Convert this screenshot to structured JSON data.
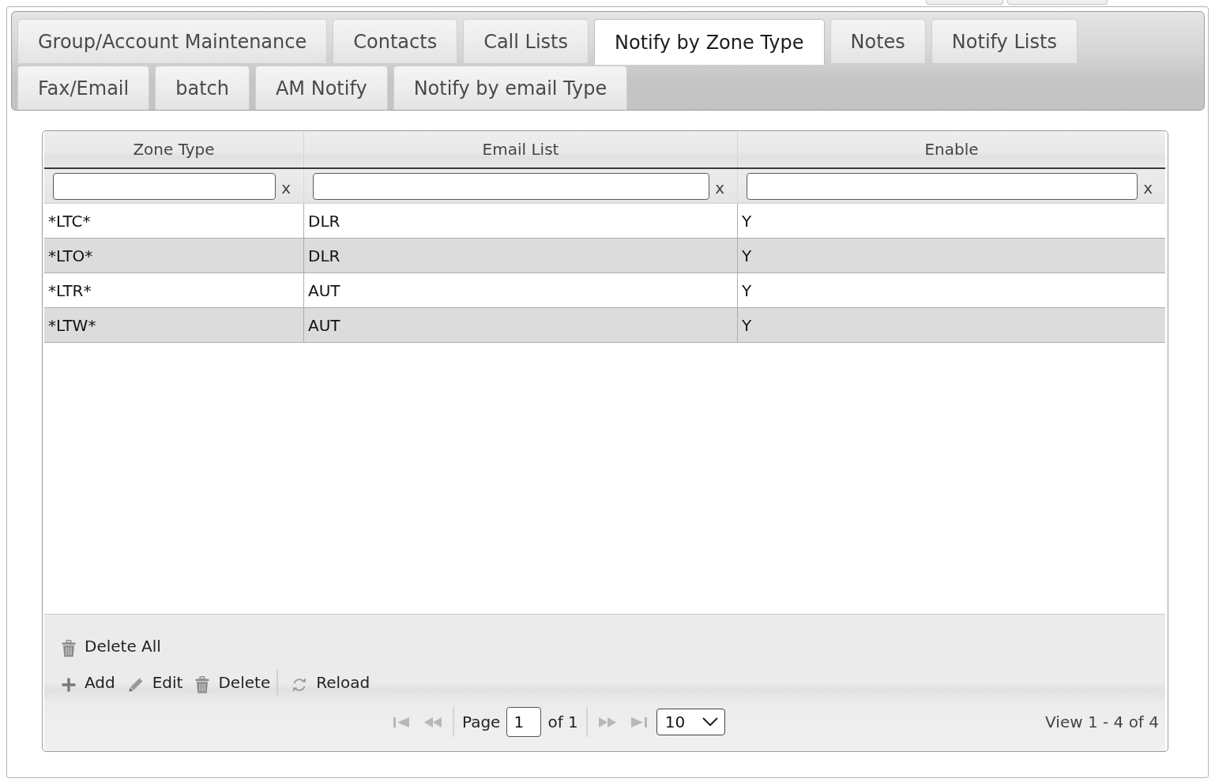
{
  "tabs": [
    {
      "label": "Group/Account Maintenance",
      "selected": false
    },
    {
      "label": "Contacts",
      "selected": false
    },
    {
      "label": "Call Lists",
      "selected": false
    },
    {
      "label": "Notify by Zone Type",
      "selected": true
    },
    {
      "label": "Notes",
      "selected": false
    },
    {
      "label": "Notify Lists",
      "selected": false
    },
    {
      "label": "Fax/Email",
      "selected": false
    },
    {
      "label": "batch",
      "selected": false
    },
    {
      "label": "AM Notify",
      "selected": false
    },
    {
      "label": "Notify by email Type",
      "selected": false
    }
  ],
  "grid": {
    "columns": [
      {
        "label": "Zone Type",
        "filter_clear": "x"
      },
      {
        "label": "Email List",
        "filter_clear": "x"
      },
      {
        "label": "Enable",
        "filter_clear": "x"
      }
    ],
    "rows": [
      {
        "cells": [
          "*LTC*",
          "DLR",
          "Y"
        ],
        "selected": false
      },
      {
        "cells": [
          "*LTO*",
          "DLR",
          "Y"
        ],
        "selected": false
      },
      {
        "cells": [
          "*LTR*",
          "AUT",
          "Y"
        ],
        "selected": false
      },
      {
        "cells": [
          "*LTW*",
          "AUT",
          "Y"
        ],
        "selected": false
      }
    ]
  },
  "toolbar": {
    "rows": [
      [
        {
          "kind": "delete_all",
          "label": "Delete All"
        }
      ],
      [
        {
          "kind": "add",
          "label": "Add"
        },
        {
          "kind": "edit",
          "label": "Edit"
        },
        {
          "kind": "delete",
          "label": "Delete"
        },
        {
          "kind": "separator"
        },
        {
          "kind": "reload",
          "label": "Reload"
        }
      ]
    ]
  },
  "pager": {
    "nav_before": [
      {
        "kind": "first",
        "disabled": true
      },
      {
        "kind": "prev",
        "disabled": true
      }
    ],
    "page_label": "Page",
    "page_value": "1",
    "page_total": "of 1",
    "nav_after": [
      {
        "kind": "next",
        "disabled": true
      },
      {
        "kind": "last",
        "disabled": true
      }
    ],
    "rows_per_page": "10",
    "record_info": "View 1 - 4 of 4"
  }
}
